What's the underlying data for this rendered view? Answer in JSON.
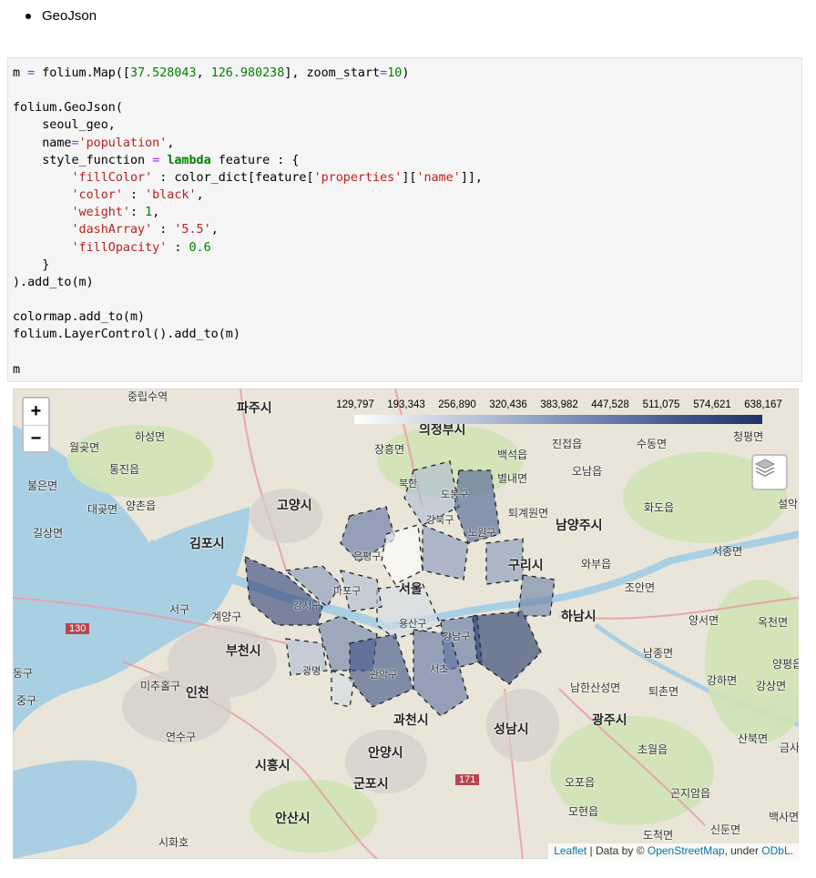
{
  "bullet": {
    "label": "GeoJson"
  },
  "code": {
    "lines": [
      "m = folium.Map([37.528043, 126.980238], zoom_start=10)",
      "",
      "folium.GeoJson(",
      "    seoul_geo,",
      "    name='population',",
      "    style_function = lambda feature : {",
      "        'fillColor' : color_dict[feature['properties']['name']],",
      "        'color' : 'black',",
      "        'weight': 1,",
      "        'dashArray' : '5.5',",
      "        'fillOpacity' : 0.6",
      "    }",
      ").add_to(m)",
      "",
      "colormap.add_to(m)",
      "folium.LayerControl().add_to(m)",
      "",
      "m"
    ]
  },
  "map": {
    "zoom_in": "+",
    "zoom_out": "−",
    "legend_ticks": [
      "129,797",
      "193,343",
      "256,890",
      "320,436",
      "383,982",
      "447,528",
      "511,075",
      "574,621",
      "638,167"
    ],
    "attribution": {
      "leaflet": "Leaflet",
      "mid": " | Data by © ",
      "osm": "OpenStreetMap",
      "under": ", under ",
      "odbl": "ODbL",
      "end": "."
    },
    "places": {
      "p1": "중립수역",
      "p2": "파주시",
      "p3": "의정부시",
      "p4": "하성면",
      "p5": "월곶면",
      "p6": "통진읍",
      "p7": "장흥면",
      "p8": "백석읍",
      "p9": "진접읍",
      "p10": "수동면",
      "p11": "청평면",
      "p12": "별내면",
      "p13": "오남읍",
      "p14": "불은면",
      "p15": "대곶면",
      "p16": "양촌읍",
      "p17": "고양시",
      "p18": "남양주시",
      "p19": "화도읍",
      "p20": "설악",
      "p21": "길상면",
      "p22": "김포시",
      "p23": "퇴계원면",
      "p24": "서종면",
      "p25": "와부읍",
      "p26": "구리시",
      "p27": "조안면",
      "p28": "서구",
      "p29": "계양구",
      "p30": "하남시",
      "p31": "양서면",
      "p32": "옥천면",
      "p33": "130",
      "p34": "부천시",
      "p35": "남종면",
      "p36": "양평읍",
      "p37": "강하면",
      "p38": "강상면",
      "p39": "동구",
      "p40": "미추홀구",
      "p41": "인천",
      "p42": "남한산성면",
      "p43": "퇴촌면",
      "p44": "중구",
      "p45": "과천시",
      "p46": "성남시",
      "p47": "광주시",
      "p48": "연수구",
      "p49": "산북면",
      "p50": "초월읍",
      "p51": "금사",
      "p52": "시흥시",
      "p53": "안양시",
      "p54": "171",
      "p55": "군포시",
      "p56": "오포읍",
      "p57": "곤지암읍",
      "p58": "모현읍",
      "p59": "백사면",
      "p60": "안산시",
      "p61": "신둔면",
      "p62": "도척면",
      "p63": "시화호"
    },
    "districts": {
      "d1": "도봉구",
      "d2": "강북구",
      "d3": "노원구",
      "d4": "북한",
      "d5": "은평구",
      "d6": "마포구",
      "d7": "서울",
      "d8": "강서구",
      "d9": "용산구",
      "d10": "강남구",
      "d11": "관악구",
      "d12": "서초",
      "d13": "광명"
    }
  }
}
